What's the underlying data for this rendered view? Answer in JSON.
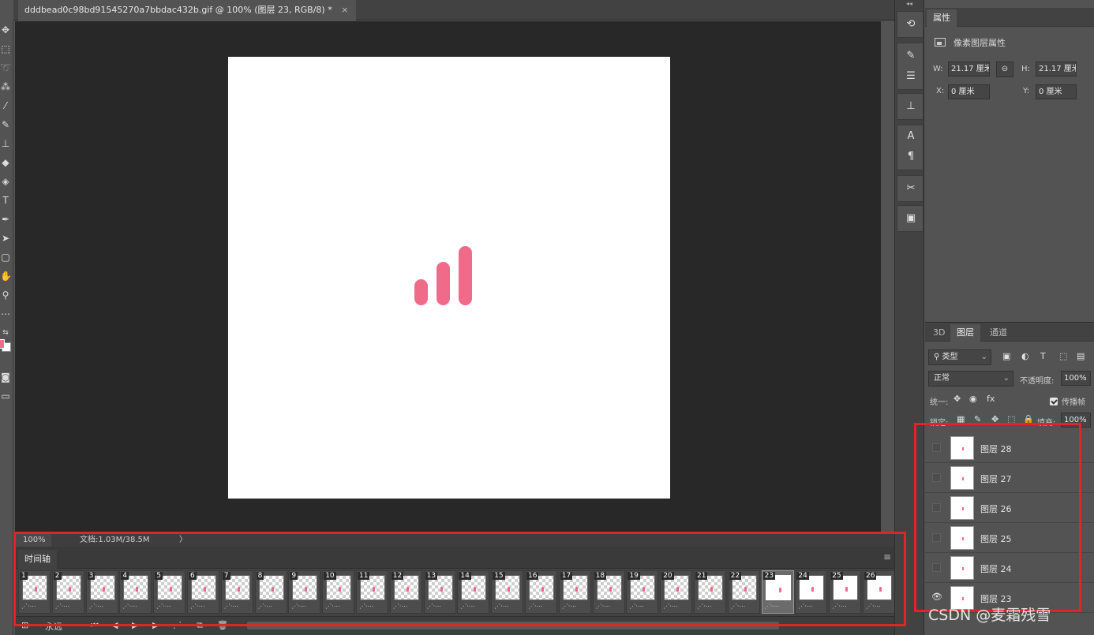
{
  "document_tab": {
    "title": "dddbead0c98bd91545270a7bbdac432b.gif @ 100% (图层 23, RGB/8) *",
    "close": "×"
  },
  "canvas": {
    "background": "#ffffff",
    "icon_color": "#f06b8a",
    "bar_levels": [
      0.33,
      0.55,
      0.75
    ]
  },
  "statusbar": {
    "zoom": "100%",
    "doc": "文档:1.03M/38.5M",
    "arrow": "〉"
  },
  "timeline": {
    "tab": "时间轴",
    "menu": "≡",
    "frames": [
      {
        "num": "1",
        "meta": "⋰·⋯"
      },
      {
        "num": "2",
        "meta": "⋰·⋯"
      },
      {
        "num": "3",
        "meta": "⋰·⋯"
      },
      {
        "num": "4",
        "meta": "⋰·⋯"
      },
      {
        "num": "5",
        "meta": "⋰·⋯"
      },
      {
        "num": "6",
        "meta": "⋰·⋯"
      },
      {
        "num": "7",
        "meta": "⋰·⋯"
      },
      {
        "num": "8",
        "meta": "⋰·⋯"
      },
      {
        "num": "9",
        "meta": "⋰·⋯"
      },
      {
        "num": "10",
        "meta": "⋰·⋯"
      },
      {
        "num": "11",
        "meta": "⋰·⋯"
      },
      {
        "num": "12",
        "meta": "⋰·⋯"
      },
      {
        "num": "13",
        "meta": "⋰·⋯"
      },
      {
        "num": "14",
        "meta": "⋰·⋯"
      },
      {
        "num": "15",
        "meta": "⋰·⋯"
      },
      {
        "num": "16",
        "meta": "⋰·⋯"
      },
      {
        "num": "17",
        "meta": "⋰·⋯"
      },
      {
        "num": "18",
        "meta": "⋰·⋯"
      },
      {
        "num": "19",
        "meta": "⋰·⋯"
      },
      {
        "num": "20",
        "meta": "⋰·⋯"
      },
      {
        "num": "21",
        "meta": "⋰·⋯"
      },
      {
        "num": "22",
        "meta": "⋰·⋯"
      },
      {
        "num": "23",
        "meta": "⋰·⋯",
        "selected": true,
        "white": true
      },
      {
        "num": "24",
        "meta": "⋰·⋯",
        "white": true
      },
      {
        "num": "25",
        "meta": "⋰·⋯",
        "white": true
      },
      {
        "num": "26",
        "meta": "⋰·⋯",
        "white": true
      }
    ],
    "controls": {
      "loop": "永远"
    }
  },
  "properties": {
    "tab": "属性",
    "subtitle": "像素图层属性",
    "w_label": "W:",
    "w_value": "21.17 厘米",
    "h_label": "H:",
    "h_value": "21.17 厘米",
    "x_label": "X:",
    "x_value": "0 厘米",
    "y_label": "Y:",
    "y_value": "0 厘米",
    "link": "⊖"
  },
  "layers_panel": {
    "tabs": [
      "3D",
      "图层",
      "通道"
    ],
    "active_tab": 1,
    "filter": "类型",
    "blend_mode": "正常",
    "opacity_label": "不透明度:",
    "opacity_value": "100%",
    "unify_label": "统一:",
    "propagate_label": "传播帧",
    "lock_label": "锁定:",
    "fill_label": "填充:",
    "fill_value": "100%",
    "layers": [
      {
        "name": "图层 28",
        "visible": false
      },
      {
        "name": "图层 27",
        "visible": false
      },
      {
        "name": "图层 26",
        "visible": false
      },
      {
        "name": "图层 25",
        "visible": false
      },
      {
        "name": "图层 24",
        "visible": false
      },
      {
        "name": "图层 23",
        "visible": true
      }
    ]
  },
  "highlight_color": "#e3222a",
  "watermark": "CSDN @麦霜残雪"
}
